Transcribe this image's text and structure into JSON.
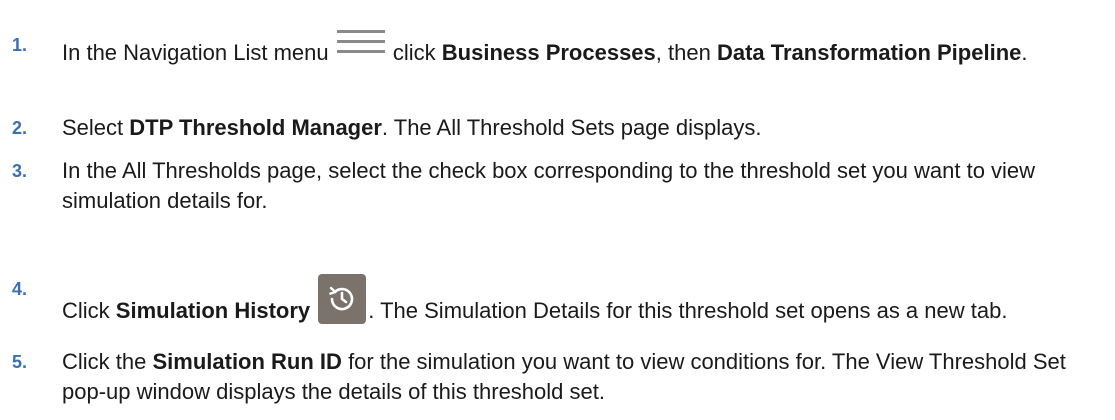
{
  "steps": [
    {
      "num": "1.",
      "t1": "In the Navigation List menu",
      "icon": "hamburger-menu-icon",
      "t2": "click",
      "b1": "Business Processes",
      "t3": ", then",
      "b2": "Data Transformation Pipeline",
      "t4": "."
    },
    {
      "num": "2.",
      "t1": "Select",
      "b1": "DTP Threshold Manager",
      "t2": ". The All Threshold Sets page displays."
    },
    {
      "num": "3.",
      "t1": "In the All Thresholds page, select the check box corresponding to the threshold set you want to view simulation details for."
    },
    {
      "num": "4.",
      "t1": "Click",
      "b1": "Simulation History",
      "icon": "history-icon",
      "t2": ". The Simulation Details for this threshold set opens as a new tab."
    },
    {
      "num": "5.",
      "t1": "Click the",
      "b1": "Simulation Run ID",
      "t2": "for the simulation you want to view conditions for. The View Threshold Set pop-up window displays the details of this threshold set."
    }
  ],
  "colors": {
    "step_number": "#3a6fb5",
    "history_button_bg": "#7b736b"
  }
}
